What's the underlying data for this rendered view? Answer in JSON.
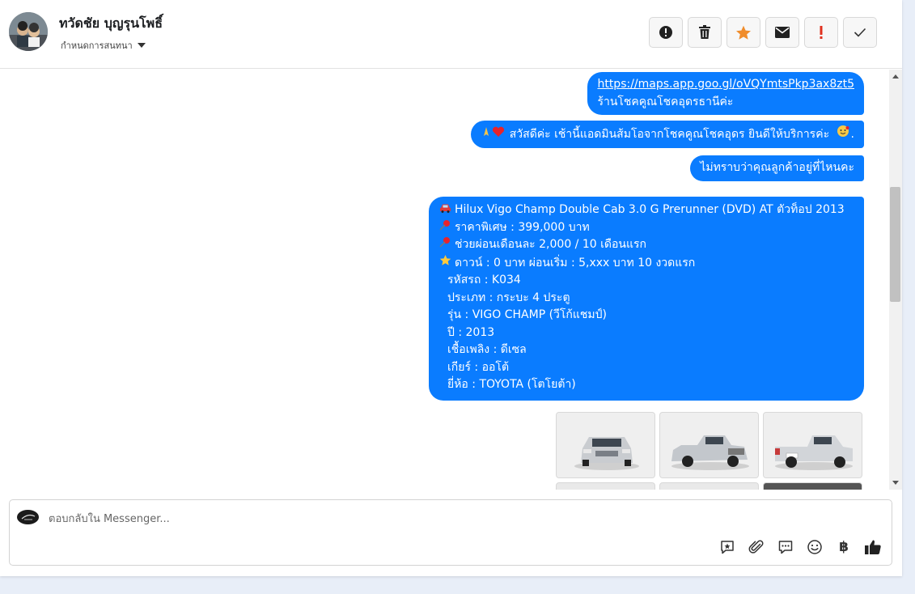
{
  "header": {
    "contact_name": "ทวัดชัย บุญรุนโพธิ์",
    "assign_label": "กำหนดการสนทนา",
    "toolbar_icons": [
      "alert-circle-icon",
      "trash-icon",
      "star-icon",
      "envelope-icon",
      "exclamation-icon",
      "check-icon"
    ],
    "star_color": "#f08c2b",
    "exclamation_color": "#e0301e"
  },
  "messages": [
    {
      "lines": [
        "https://maps.app.goo.gl/oVQYmtsPkp3ax8zt5",
        "ร้านโชคคูณโชคอุดรธานีค่ะ"
      ]
    },
    {
      "text": "สวัสดีค่ะ เช้านี้แอดมินส้มโอจากโชคคูณโชคอุดร ยินดีให้บริการค่ะ",
      "trailing": "."
    },
    {
      "text": "ไม่ทราบว่าคุณลูกค้าอยู่ที่ไหนคะ"
    },
    {
      "lines": [
        "Hilux Vigo Champ Double Cab 3.0 G Prerunner (DVD) AT ตัวท็อป  2013",
        "ราคาพิเศษ : 399,000 บาท",
        "ช่วยผ่อนเดือนละ 2,000 / 10 เดือนแรก",
        "ดาวน์ : 0 บาท ผ่อนเริ่ม : 5,xxx บาท 10 งวดแรก",
        "รหัสรถ : K034",
        "ประเภท : กระบะ 4 ประตู",
        "รุ่น : VIGO CHAMP (วีโก้แชมป์)",
        "ปี : 2013",
        "เชื้อเพลิง : ดีเซล",
        "เกียร์ : ออโต้",
        "ยี่ห้อ : TOYOTA (โตโยต้า)"
      ]
    }
  ],
  "composer": {
    "placeholder": "ตอบกลับใน Messenger...",
    "currency_symbol": "฿",
    "tool_icons": [
      "saved-reply-icon",
      "paperclip-icon",
      "chat-bubble-icon",
      "emoji-icon",
      "baht-icon",
      "thumbs-up-icon"
    ]
  },
  "colors": {
    "bubble": "#0a7cff",
    "background": "#e8eef8"
  }
}
